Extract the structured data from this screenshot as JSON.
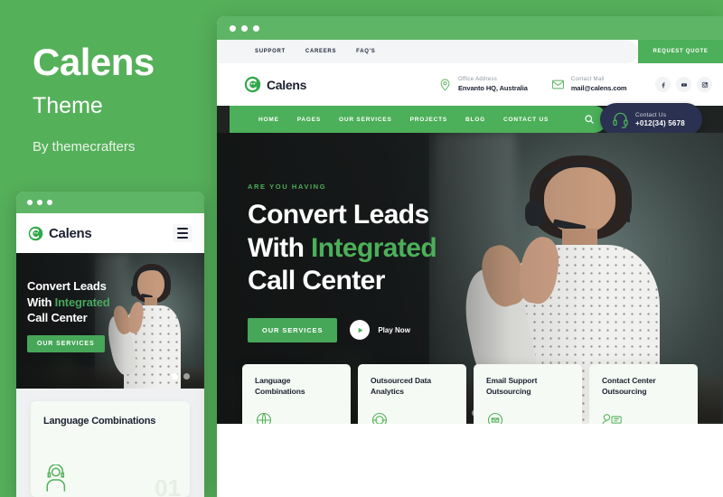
{
  "promo": {
    "title": "Calens",
    "subtitle": "Theme",
    "byline": "By themecrafters"
  },
  "colors": {
    "brand_green": "#55b05a",
    "accent_green": "#4caf59",
    "dark_navy": "#2b3150",
    "card_bg": "#f5faf4"
  },
  "mobile": {
    "logo_name": "Calens",
    "menu_icon": "hamburger-icon",
    "hero": {
      "line1": "Convert Leads",
      "line2_plain": "With ",
      "line2_highlight": "Integrated",
      "line3": "Call Center",
      "cta_label": "OUR SERVICES"
    },
    "card": {
      "title": "Language Combinations",
      "number": "01",
      "icon": "agent-headset-icon"
    }
  },
  "desktop": {
    "topbar": {
      "links": [
        "SUPPORT",
        "CAREERS",
        "FAQ'S"
      ],
      "quote_button": "REQUEST QUOTE"
    },
    "header": {
      "logo_name": "Calens",
      "info": [
        {
          "label": "Office Address",
          "value": "Envanto HQ, Australia",
          "icon": "location-pin-icon"
        },
        {
          "label": "Contact Mail",
          "value": "mail@calens.com",
          "icon": "envelope-icon"
        }
      ],
      "socials": [
        "facebook-icon",
        "youtube-icon",
        "instagram-icon"
      ]
    },
    "nav": {
      "links": [
        "HOME",
        "PAGES",
        "OUR SERVICES",
        "PROJECTS",
        "BLOG",
        "CONTACT US"
      ],
      "search_icon": "search-icon",
      "phone_widget": {
        "label": "Contact Us",
        "number": "+012(34) 5678",
        "icon": "headset-icon"
      }
    },
    "hero": {
      "eyebrow": "ARE YOU HAVING",
      "line1": "Convert Leads",
      "line2_plain": "With ",
      "line2_highlight": "Integrated",
      "line3": "Call Center",
      "cta_label": "OUR SERVICES",
      "play_label": "Play Now",
      "play_icon": "play-icon",
      "carousel_dots": 2,
      "active_dot": 1
    },
    "cards": [
      {
        "title": "Language Combinations",
        "icon": "globe-outline-icon"
      },
      {
        "title": "Outsourced Data Analytics",
        "icon": "data-circle-icon"
      },
      {
        "title": "Email Support Outsourcing",
        "icon": "mail-circle-icon"
      },
      {
        "title": "Contact Center Outsourcing",
        "icon": "agent-monitor-icon"
      }
    ]
  }
}
